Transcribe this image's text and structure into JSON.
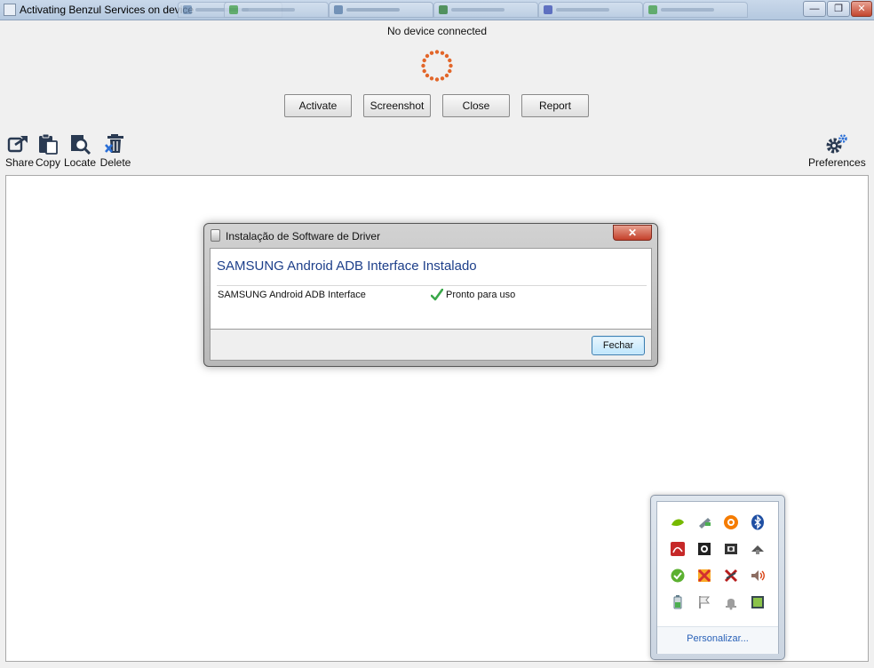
{
  "window": {
    "title": "Activating Benzul Services on device"
  },
  "browser_tabs": [
    {
      "name": "tab-1"
    },
    {
      "name": "tab-2"
    },
    {
      "name": "tab-3"
    },
    {
      "name": "tab-4"
    },
    {
      "name": "tab-5"
    },
    {
      "name": "tab-6"
    }
  ],
  "window_controls": {
    "minimize": "—",
    "maximize": "❐",
    "close": "✕"
  },
  "status": {
    "text": "No device connected"
  },
  "actions": {
    "activate": "Activate",
    "screenshot": "Screenshot",
    "close": "Close",
    "report": "Report"
  },
  "toolbar": {
    "share": "Share",
    "copy": "Copy",
    "locate": "Locate",
    "delete": "Delete",
    "preferences": "Preferences"
  },
  "dialog": {
    "title": "Instalação de Software de Driver",
    "close_glyph": "✕",
    "heading": "SAMSUNG Android ADB Interface Instalado",
    "device": "SAMSUNG Android ADB Interface",
    "status": "Pronto para uso",
    "button": "Fechar"
  },
  "tray": {
    "link": "Personalizar...",
    "icons": [
      "nvidia-icon",
      "usb-icon",
      "avast-icon",
      "bluetooth-icon",
      "acrobat-icon",
      "app-icon-2",
      "app-icon-3",
      "network-icon",
      "update-icon",
      "antivirus-icon",
      "flash-icon",
      "volume-icon",
      "battery-icon",
      "flag-icon",
      "notification-icon",
      "display-icon"
    ]
  },
  "colors": {
    "accent": "#1d3f8a",
    "spinner": "#e2662a",
    "success": "#3aa84a"
  }
}
